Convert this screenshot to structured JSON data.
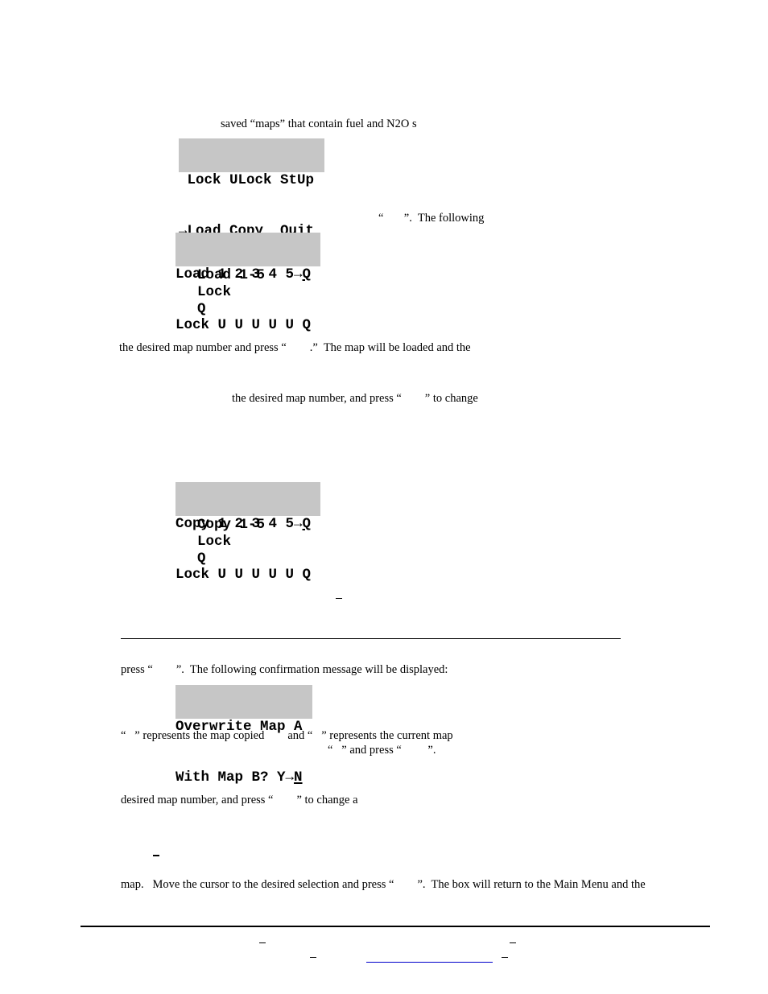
{
  "paragraphs": {
    "p1": "saved “maps” that contain fuel and N2O s",
    "p2": "“       ”.  The following",
    "p3": "the desired map number and press “        .”  The map will be loaded and the",
    "p4": "the desired map number, and press “        ” to change",
    "p5": "press “        ”.  The following confirmation message will be displayed:",
    "p6": "“   ” represents the map copied        and “   ” represents the current map",
    "p7": "“   ” and press “         ”.",
    "p8": "desired map number, and press “        ” to change a",
    "p9": "map.   Move the cursor to the desired selection and press “        ”.  The box will return to the Main Menu and the"
  },
  "main_menu_lcd": {
    "row1": " Lock ULock StUp",
    "row2_arrow": "→",
    "row2_cursor": "L",
    "row2_rest": "oad Copy  Quit"
  },
  "load_lcd": {
    "row1_text": "Load 1 2 3 4 5→",
    "row1_cursor": "Q",
    "row2_text": "Lock U U U U U ",
    "row2_end": "Q",
    "legend": [
      "Load 1-5",
      "Lock",
      "Q"
    ]
  },
  "copy_lcd": {
    "row1_text": "Copy 1 2 3 4 5→",
    "row1_cursor": "Q",
    "row2_text": "Lock U U U U U ",
    "row2_end": "Q",
    "legend": [
      "Copy 1-5",
      "Lock",
      "Q"
    ]
  },
  "overwrite_lcd": {
    "row1": "Overwrite Map A",
    "row2_text": "With Map B? Y→",
    "row2_cursor": "N"
  }
}
